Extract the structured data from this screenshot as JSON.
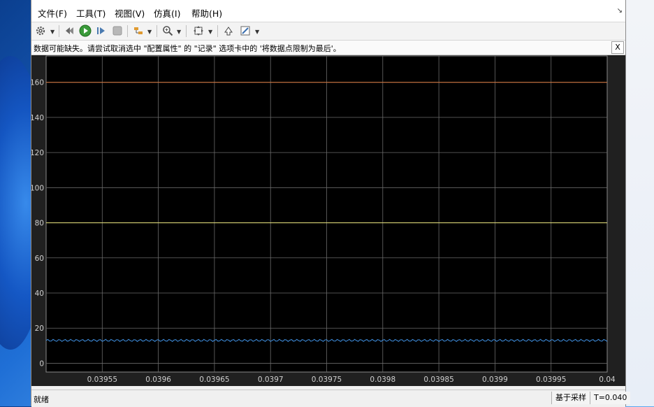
{
  "menu": {
    "items": [
      {
        "label": "文件(F)"
      },
      {
        "label": "工具(T)"
      },
      {
        "label": "视图(V)"
      },
      {
        "label": "仿真(I)"
      },
      {
        "label": "帮助(H)"
      }
    ],
    "collapse_arrow": "↘"
  },
  "toolbar": {
    "icons": [
      "gear-icon",
      "rewind-icon",
      "run-icon",
      "step-forward-icon",
      "stop-icon",
      "signal-select-icon",
      "zoom-icon",
      "fit-to-view-icon",
      "restore-icon",
      "style-icon"
    ]
  },
  "infobar": {
    "message": "数据可能缺失。请尝试取消选中 \"配置属性\" 的 \"记录\" 选项卡中的 '将数据点限制为最后'。",
    "close_label": "X"
  },
  "status": {
    "left": "就绪",
    "mode": "基于采样",
    "time": "T=0.040"
  },
  "chart_data": {
    "type": "line",
    "x_tick_labels": [
      "0.03955",
      "0.0396",
      "0.03965",
      "0.0397",
      "0.03975",
      "0.0398",
      "0.03985",
      "0.0399",
      "0.03995",
      "0.04"
    ],
    "y_tick_labels": [
      "0",
      "20",
      "40",
      "60",
      "80",
      "100",
      "120",
      "140",
      "160"
    ],
    "xlim": [
      0.0395,
      0.04
    ],
    "ylim": [
      -5,
      175
    ],
    "grid": true,
    "series": [
      {
        "color": "#d9773b",
        "x": [
          0.0395,
          0.04
        ],
        "y": [
          160,
          160
        ]
      },
      {
        "color": "#e8e27a",
        "x": [
          0.0395,
          0.04
        ],
        "y": [
          80,
          80
        ]
      },
      {
        "color": "#3f8fe0",
        "x": [
          0.0395,
          0.04
        ],
        "y": [
          13,
          13
        ],
        "ripple": 0.6
      }
    ],
    "colors": {
      "background": "#000000",
      "grid": "#6a6a6a",
      "frame_bg": "#202020"
    }
  }
}
